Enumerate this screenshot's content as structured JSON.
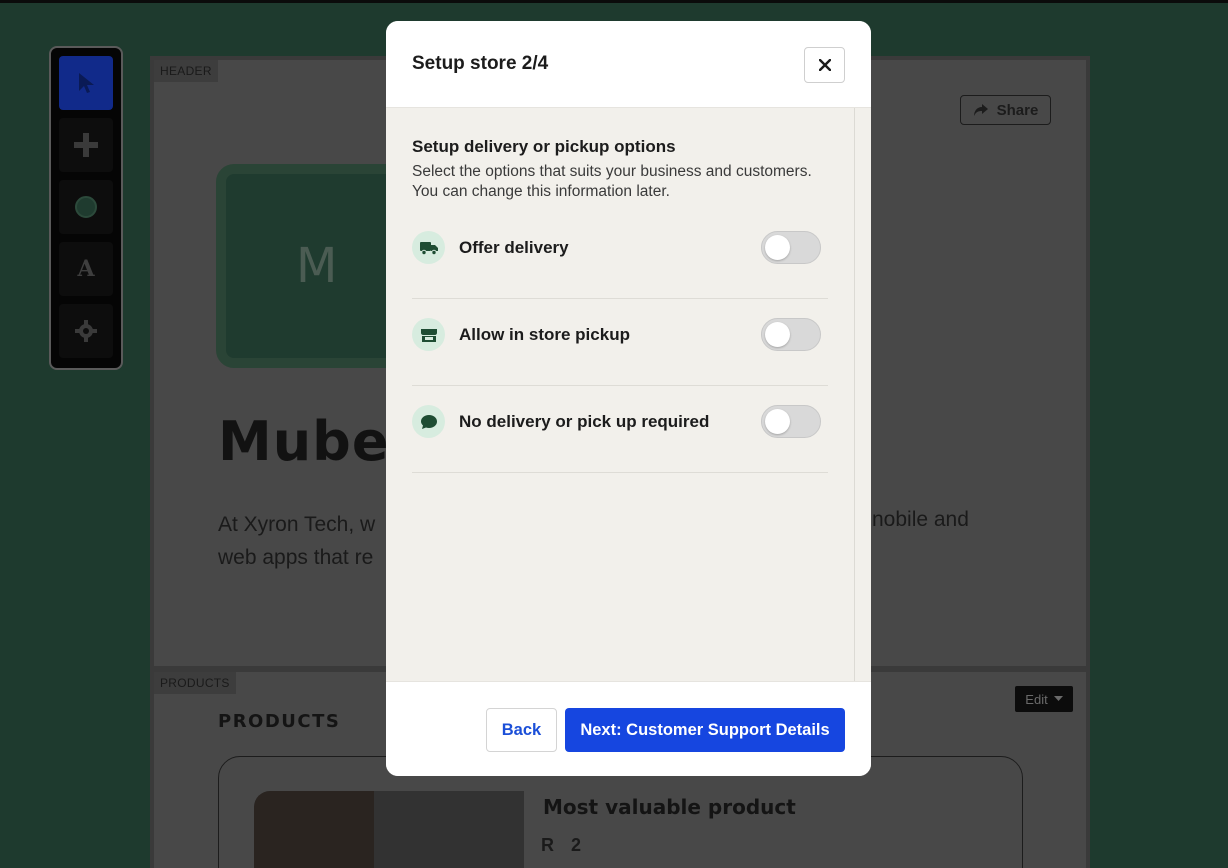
{
  "editor": {
    "toolbar": [
      "pointer-tool",
      "add-tool",
      "shape-tool",
      "text-tool",
      "settings-tool"
    ],
    "text_tool_label": "A",
    "header_tag": "HEADER",
    "products_tag": "PRODUCTS",
    "share_label": "Share",
    "logo_letter": "M",
    "hero_title": "Mube",
    "hero_text_line1": "At Xyron Tech, w",
    "hero_text_line2": "web apps that re",
    "hero_text_right": "nobile and",
    "edit_label": "Edit",
    "products_title": "PRODUCTS",
    "product_name": "Most valuable product",
    "product_price": "R 2"
  },
  "modal": {
    "title": "Setup store 2/4",
    "section_title": "Setup delivery or pickup options",
    "section_desc": "Select the options that suits your business and customers. You can change this information later.",
    "options": [
      {
        "label": "Offer delivery",
        "icon": "truck-icon",
        "enabled": false
      },
      {
        "label": "Allow in store pickup",
        "icon": "store-icon",
        "enabled": false
      },
      {
        "label": "No delivery or pick up required",
        "icon": "chat-icon",
        "enabled": false
      }
    ],
    "back_label": "Back",
    "next_label": "Next: Customer Support Details"
  },
  "colors": {
    "accent": "#1646e0",
    "icon_bg": "#d7ecdf",
    "icon_fg": "#1e4d33",
    "backdrop": "#1e3a2e"
  }
}
